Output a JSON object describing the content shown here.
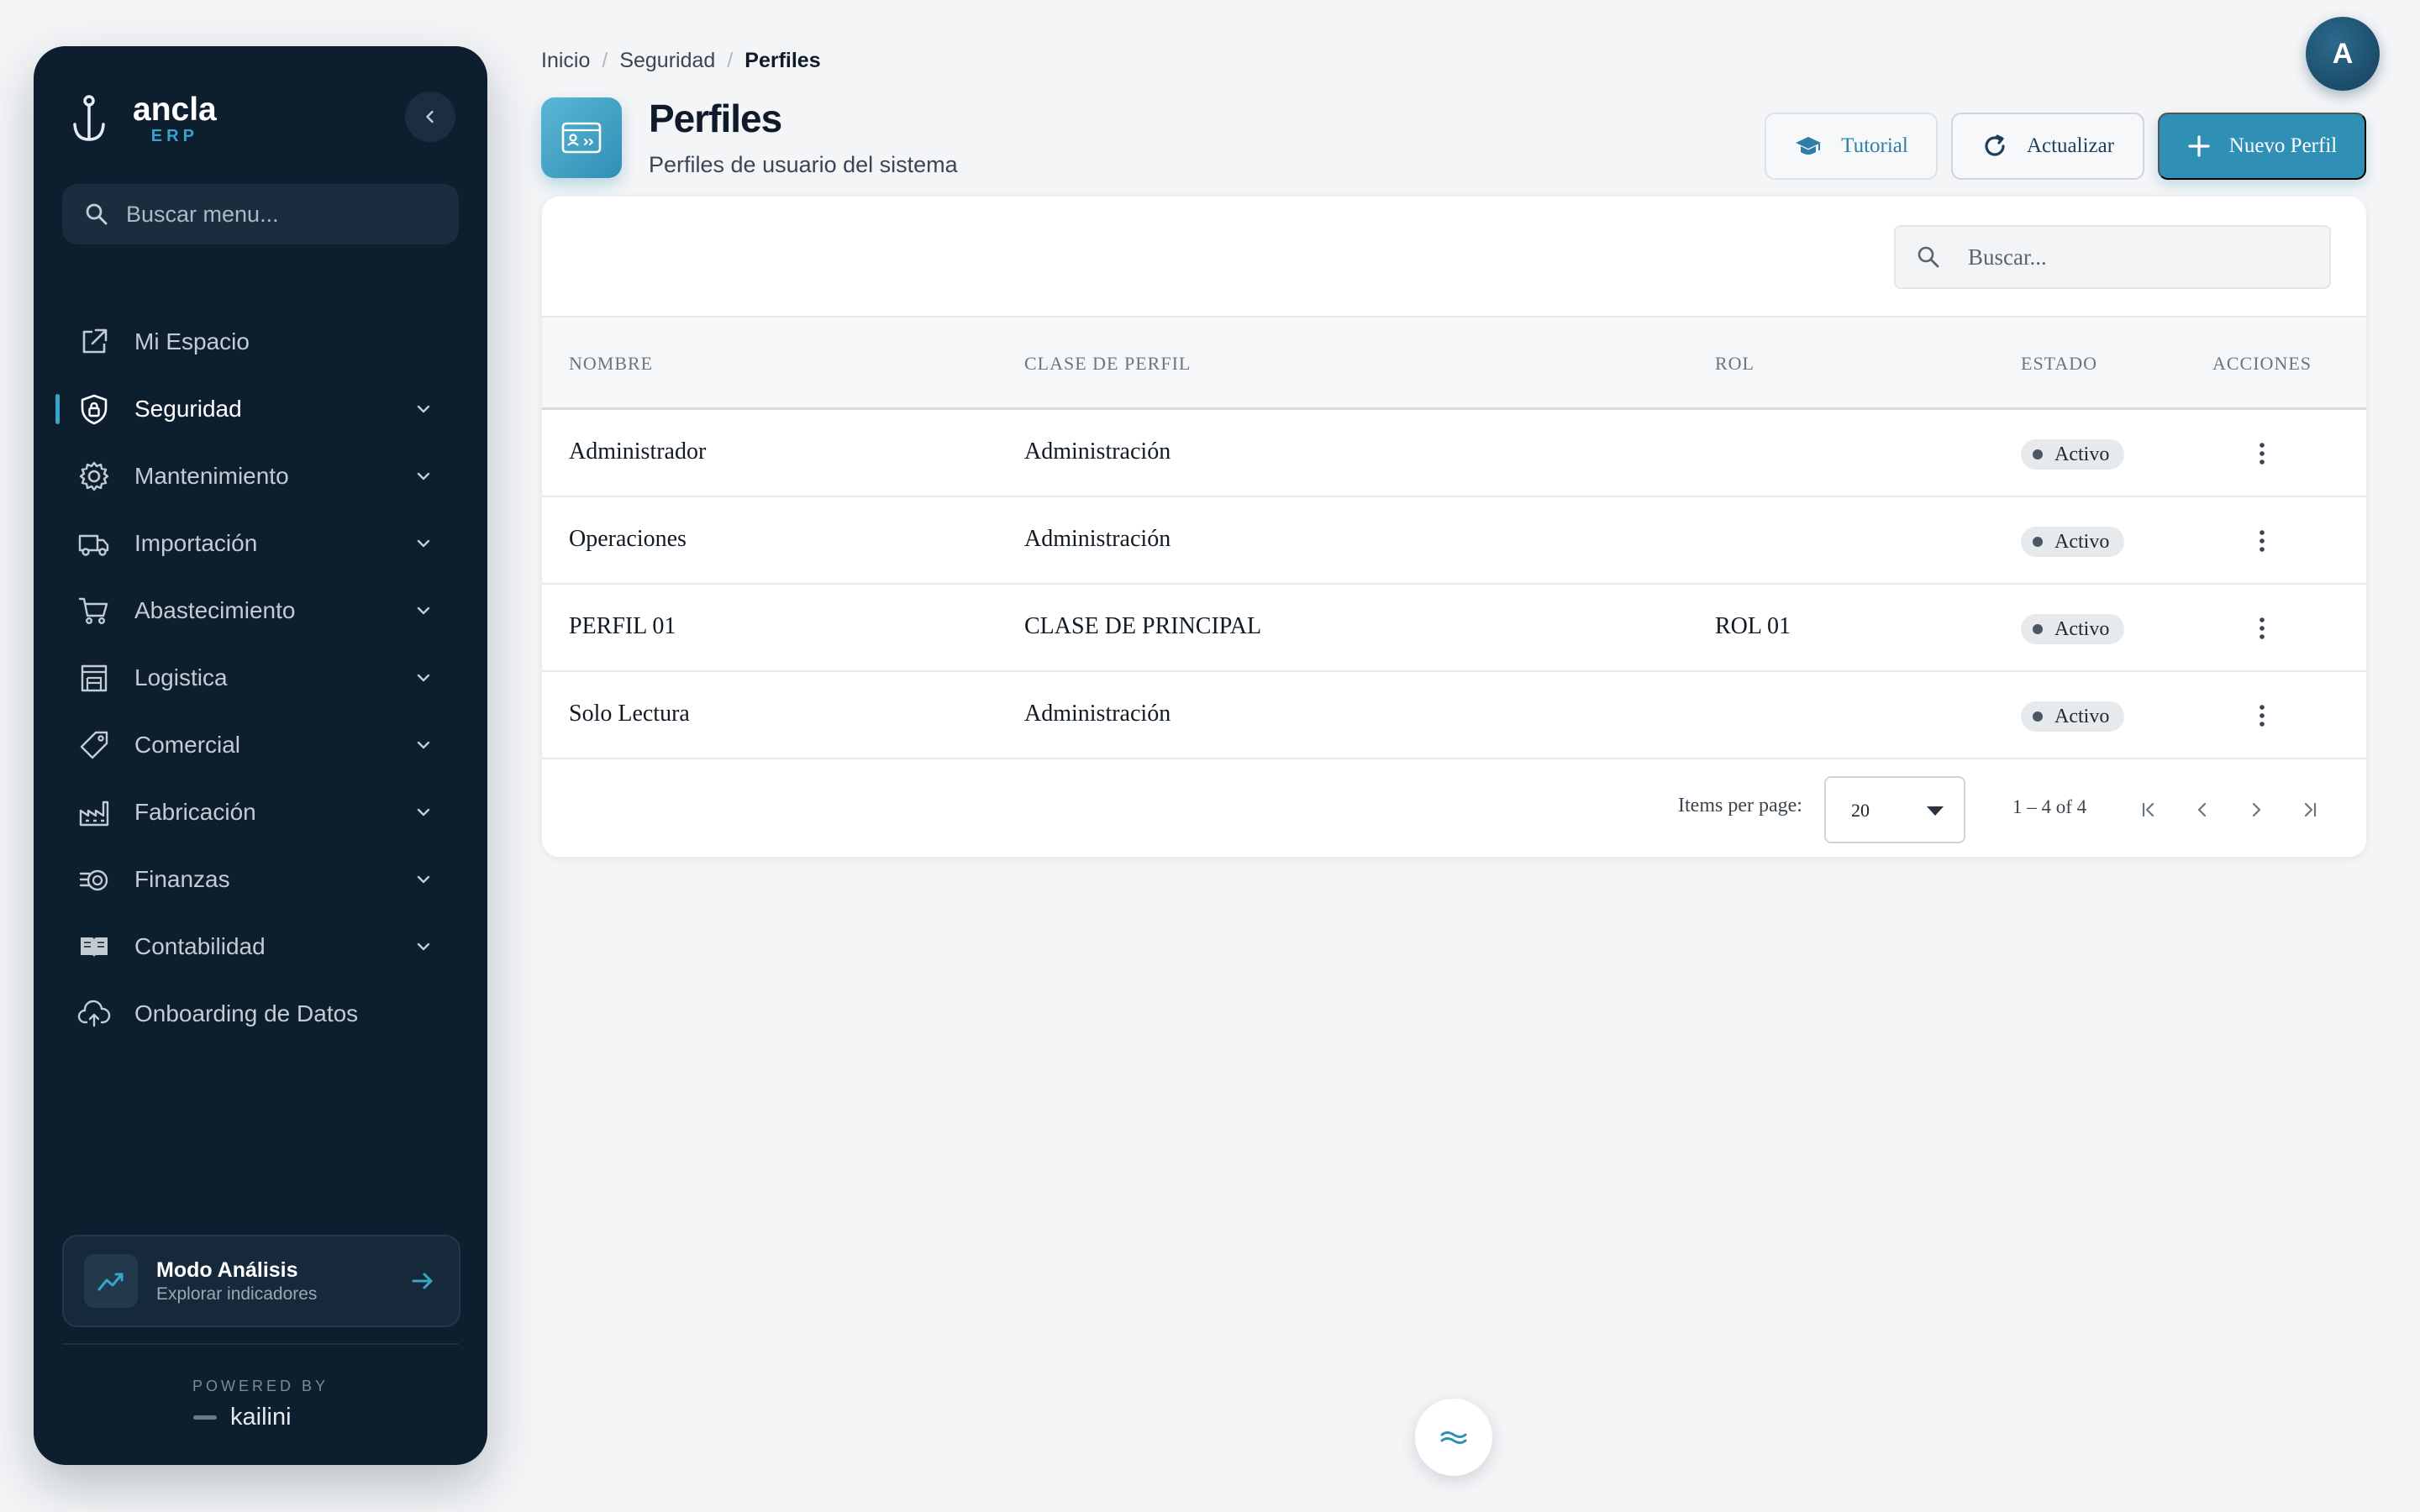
{
  "app": {
    "name": "ancla",
    "suffix": "ERP"
  },
  "sidebar": {
    "search_placeholder": "Buscar menu...",
    "items": [
      {
        "label": "Mi Espacio",
        "icon": "external-link-icon",
        "expandable": false,
        "active": false
      },
      {
        "label": "Seguridad",
        "icon": "shield-lock-icon",
        "expandable": true,
        "active": true
      },
      {
        "label": "Mantenimiento",
        "icon": "gear-icon",
        "expandable": true,
        "active": false
      },
      {
        "label": "Importación",
        "icon": "truck-icon",
        "expandable": true,
        "active": false
      },
      {
        "label": "Abastecimiento",
        "icon": "cart-icon",
        "expandable": true,
        "active": false
      },
      {
        "label": "Logistica",
        "icon": "warehouse-icon",
        "expandable": true,
        "active": false
      },
      {
        "label": "Comercial",
        "icon": "tag-icon",
        "expandable": true,
        "active": false
      },
      {
        "label": "Fabricación",
        "icon": "factory-icon",
        "expandable": true,
        "active": false
      },
      {
        "label": "Finanzas",
        "icon": "coins-icon",
        "expandable": true,
        "active": false
      },
      {
        "label": "Contabilidad",
        "icon": "book-icon",
        "expandable": true,
        "active": false
      },
      {
        "label": "Onboarding de Datos",
        "icon": "cloud-upload-icon",
        "expandable": false,
        "active": false
      }
    ],
    "analysis": {
      "title": "Modo Análisis",
      "subtitle": "Explorar indicadores"
    },
    "powered_by": "POWERED BY",
    "vendor": "kailini"
  },
  "header": {
    "breadcrumb": [
      "Inicio",
      "Seguridad",
      "Perfiles"
    ],
    "avatar_initial": "A",
    "title": "Perfiles",
    "subtitle": "Perfiles de usuario del sistema",
    "buttons": {
      "tutorial": "Tutorial",
      "refresh": "Actualizar",
      "new": "Nuevo Perfil"
    }
  },
  "table": {
    "search_placeholder": "Buscar...",
    "columns": [
      "NOMBRE",
      "CLASE DE PERFIL",
      "ROL",
      "ESTADO",
      "ACCIONES"
    ],
    "rows": [
      {
        "nombre": "Administrador",
        "clase": "Administración",
        "rol": "",
        "estado": "Activo"
      },
      {
        "nombre": "Operaciones",
        "clase": "Administración",
        "rol": "",
        "estado": "Activo"
      },
      {
        "nombre": "PERFIL 01",
        "clase": "CLASE DE PRINCIPAL",
        "rol": "ROL 01",
        "estado": "Activo"
      },
      {
        "nombre": "Solo Lectura",
        "clase": "Administración",
        "rol": "",
        "estado": "Activo"
      }
    ]
  },
  "pagination": {
    "label": "Items per page:",
    "page_size": "20",
    "range": "1 – 4 of 4"
  },
  "colors": {
    "accent": "#2f8fb4",
    "sidebar_bg": "#0d1e2e",
    "brand_sub": "#3aa3c8"
  }
}
